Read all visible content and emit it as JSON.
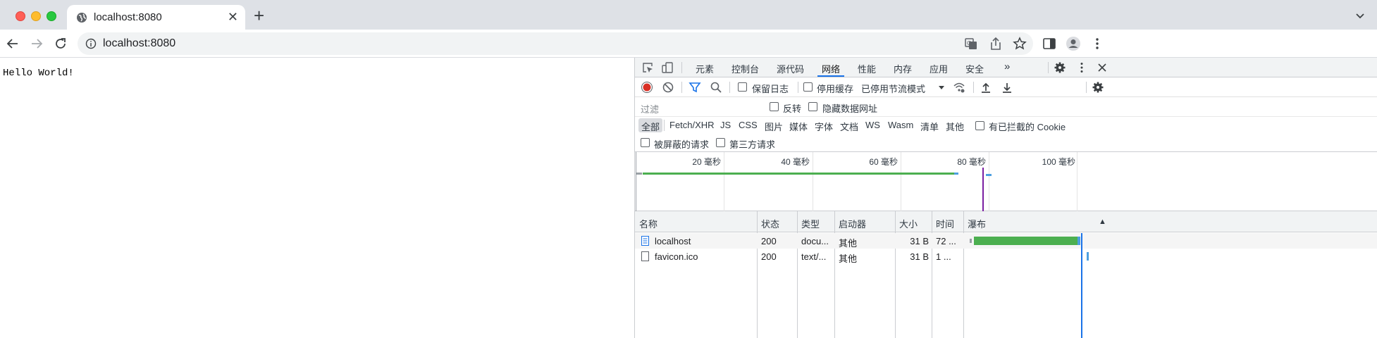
{
  "browser": {
    "tab_title": "localhost:8080",
    "url": "localhost:8080"
  },
  "page": {
    "body_text": "Hello World!"
  },
  "devtools": {
    "tabs": [
      "元素",
      "控制台",
      "源代码",
      "网络",
      "性能",
      "内存",
      "应用",
      "安全"
    ],
    "active_tab": "网络",
    "more_tabs": "»",
    "toolbar": {
      "preserve_log": "保留日志",
      "disable_cache": "停用缓存",
      "throttling": "已停用节流模式"
    },
    "filter": {
      "placeholder": "过滤",
      "invert": "反转",
      "hide_data_urls": "隐藏数据网址"
    },
    "types": [
      "全部",
      "Fetch/XHR",
      "JS",
      "CSS",
      "图片",
      "媒体",
      "字体",
      "文档",
      "WS",
      "Wasm",
      "清单",
      "其他"
    ],
    "active_type": "全部",
    "blocked_cookies": "有已拦截的 Cookie",
    "blocked_requests": "被屏蔽的请求",
    "third_party": "第三方请求",
    "timeline_ticks": [
      "20 毫秒",
      "40 毫秒",
      "60 毫秒",
      "80 毫秒",
      "100 毫秒"
    ],
    "columns": [
      "名称",
      "状态",
      "类型",
      "启动器",
      "大小",
      "时间",
      "瀑布"
    ],
    "rows": [
      {
        "name": "localhost",
        "status": "200",
        "type": "docu...",
        "initiator": "其他",
        "size": "31 B",
        "time": "72 ...",
        "waterfall_start": 0.05,
        "waterfall_end": 0.93
      },
      {
        "name": "favicon.ico",
        "status": "200",
        "type": "text/...",
        "initiator": "其他",
        "size": "31 B",
        "time": "1 ...",
        "waterfall_start": 0.985,
        "waterfall_end": 1.0
      }
    ]
  },
  "colors": {
    "record_red": "#d93025",
    "accent_blue": "#1a73e8",
    "waterfall_green": "#4caf50",
    "waterfall_blue": "#4d9fe0",
    "dom_marker": "#7b1fa2"
  }
}
